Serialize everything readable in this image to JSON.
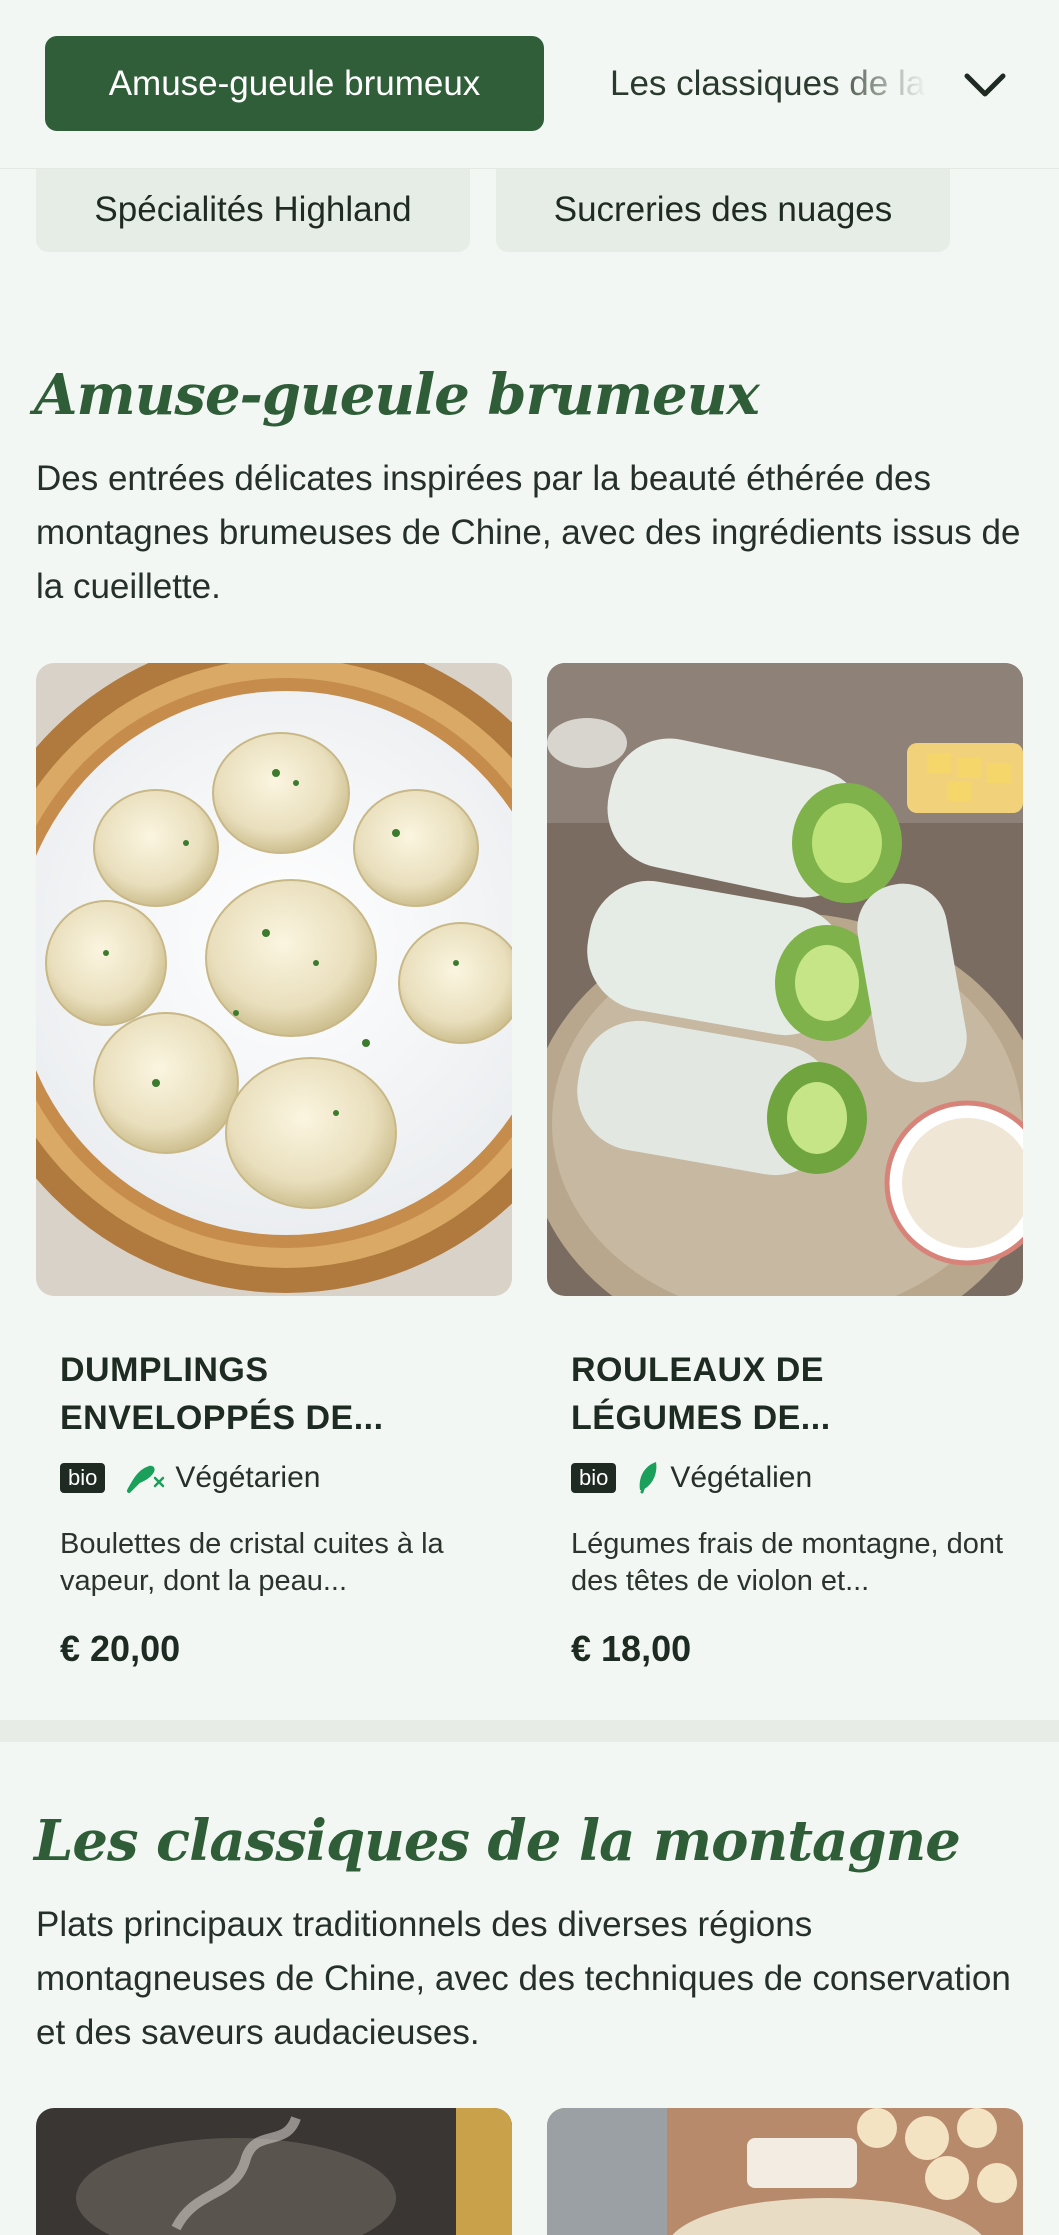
{
  "nav": {
    "active": "Amuse-gueule brumeux",
    "second": "Les classiques de la montagne",
    "chips": [
      "Spécialités Highland",
      "Sucreries des nuages"
    ]
  },
  "sections": [
    {
      "title": "Amuse-gueule brumeux",
      "description": "Des entrées délicates inspirées par la beauté éthérée des montagnes brumeuses de Chine, avec des ingrédients issus de la cueillette.",
      "items": [
        {
          "name": "DUMPLINGS ENVELOPPÉS DE...",
          "badge": "bio",
          "diet": "Végétarien",
          "diet_icon": "vegetarian-icon",
          "description": "Boulettes de cristal cuites à la vapeur, dont la peau...",
          "price": "€ 20,00"
        },
        {
          "name": "ROULEAUX DE LÉGUMES DE...",
          "badge": "bio",
          "diet": "Végétalien",
          "diet_icon": "vegan-leaf-icon",
          "description": "Légumes frais de montagne, dont des têtes de violon et...",
          "price": "€ 18,00"
        }
      ]
    },
    {
      "title": "Les classiques de la montagne",
      "description": "Plats principaux traditionnels des diverses régions montagneuses de Chine, avec des techniques de conservation et des saveurs audacieuses."
    }
  ],
  "colors": {
    "accent": "#2f5e39",
    "background": "#f3f7f3",
    "chip": "#e6ece6",
    "diet_green": "#1aa05a"
  }
}
